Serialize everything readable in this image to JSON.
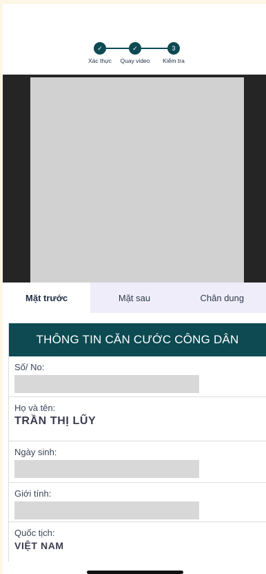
{
  "stepper": {
    "steps": [
      {
        "label": "Xác thực",
        "state": "done",
        "mark": "✓"
      },
      {
        "label": "Quay video",
        "state": "done",
        "mark": "✓"
      },
      {
        "label": "Kiểm tra",
        "state": "current",
        "mark": "3"
      }
    ]
  },
  "tabs": [
    {
      "label": "Mặt trước",
      "active": true
    },
    {
      "label": "Mặt sau",
      "active": false
    },
    {
      "label": "Chân dung",
      "active": false
    }
  ],
  "card": {
    "title": "THÔNG TIN CĂN CƯỚC CÔNG DÂN",
    "fields": {
      "so": {
        "label": "Số/ No:"
      },
      "ho_ten": {
        "label": "Họ và tên:",
        "value": "TRẦN THỊ LŨY"
      },
      "ngay_sinh": {
        "label": "Ngày sinh:"
      },
      "gioi_tinh": {
        "label": "Giới tính:"
      },
      "quoc_tich": {
        "label": "Quốc tịch:",
        "value": "VIỆT NAM"
      }
    }
  },
  "colors": {
    "accent": "#0d4a52",
    "tab_background": "#efedf9",
    "placeholder": "#d8d8d8",
    "preview_background": "#252525"
  }
}
